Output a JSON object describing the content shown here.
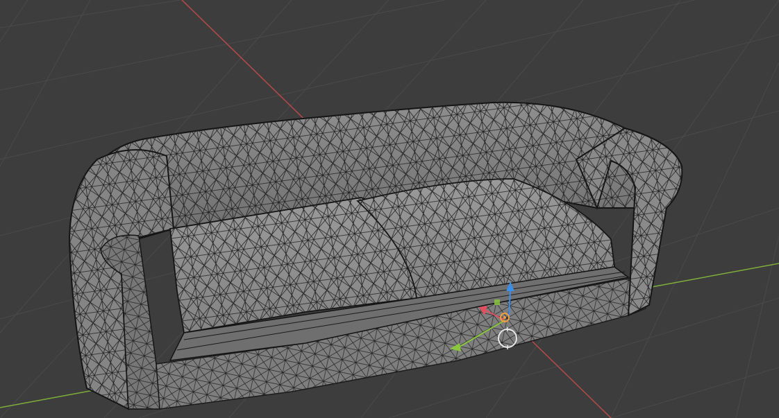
{
  "viewport": {
    "background_color": "#3d3d3d",
    "grid_color": "#4a4a4a",
    "x_axis_color": "#b84a4a",
    "y_axis_color": "#7fae3c",
    "object": "sofa",
    "display_mode": "wireframe-over-solid",
    "mesh_fill_color": "#8c8c8c",
    "mesh_wire_color": "#1e1e1e"
  },
  "gizmo": {
    "x_handle_color": "#e05060",
    "y_handle_color": "#8cc63f",
    "z_handle_color": "#3d8ee8",
    "origin_color": "#f0a040",
    "icons": [
      "translate-x-arrow",
      "translate-y-arrow",
      "translate-z-arrow",
      "origin-pivot",
      "3d-cursor"
    ]
  }
}
